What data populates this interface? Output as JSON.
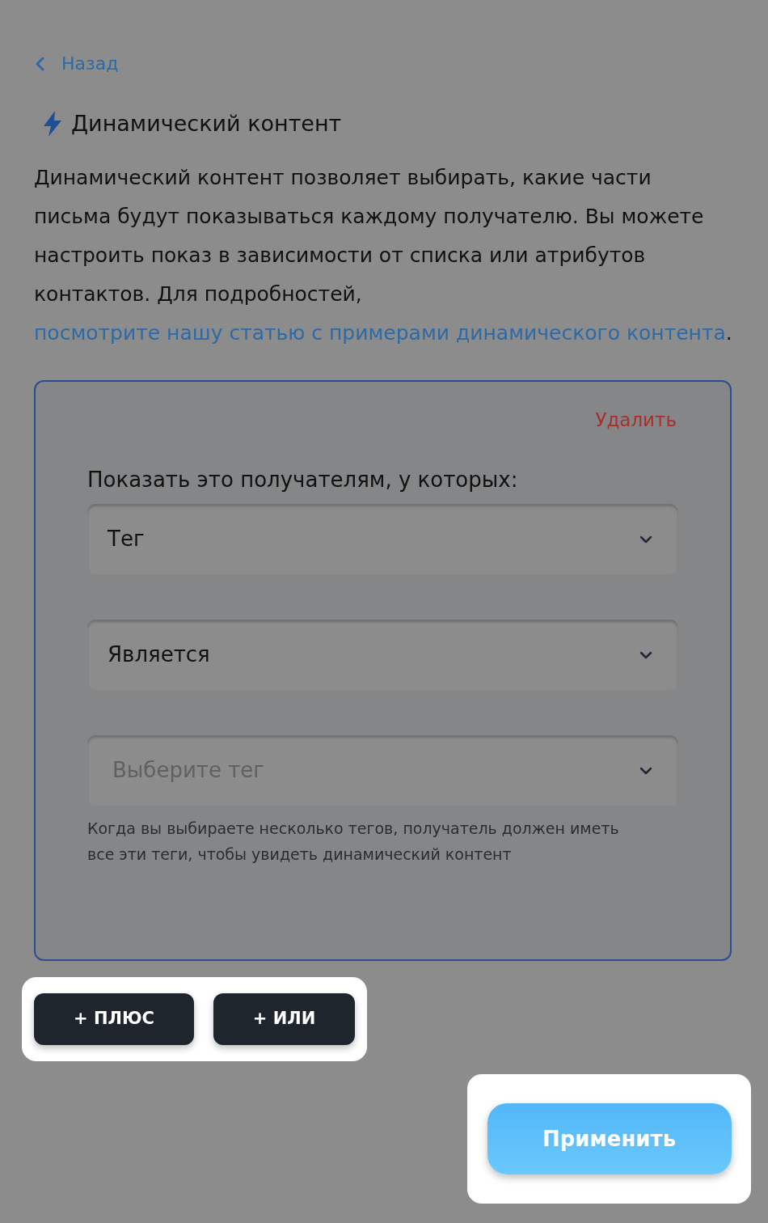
{
  "back_link": "Назад",
  "title": "Динамический контент",
  "description": {
    "text": "Динамический контент позволяет выбирать, какие части письма будут показываться каждому получателю. Вы можете настроить показ в зависимости от списка или атрибутов контактов. Для подробностей, ",
    "link": "посмотрите нашу статью с примерами динамического контента",
    "after": "."
  },
  "rule": {
    "delete": "Удалить",
    "label": "Показать это получателям, у которых:",
    "selects": [
      {
        "value": "Тег"
      },
      {
        "value": "Является"
      },
      {
        "placeholder": "Выберите тег"
      }
    ],
    "hint": "Когда вы выбираете несколько тегов, получатель должен иметь все эти теги, чтобы увидеть динамический контент"
  },
  "add_buttons": [
    "+ ПЛЮС",
    "+ ИЛИ"
  ],
  "apply": "Применить"
}
